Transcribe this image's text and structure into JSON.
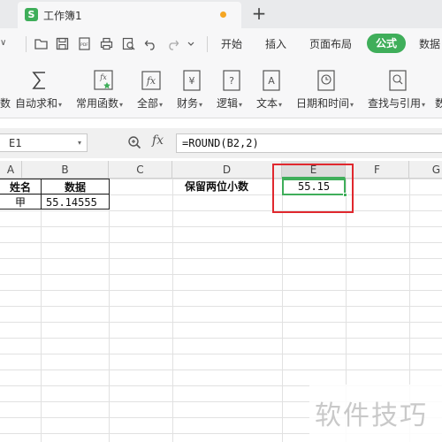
{
  "tab": {
    "title": "工作簿1",
    "app_icon_letter": "S",
    "new_tab": "+"
  },
  "menu": {
    "caret": "∨",
    "items": [
      "开始",
      "插入",
      "页面布局"
    ],
    "active": "公式",
    "cut_off": "数据"
  },
  "ribbon": {
    "left_cut": "数",
    "items": [
      {
        "label": "自动求和",
        "icon": "sigma-icon"
      },
      {
        "label": "常用函数",
        "icon": "function-star-icon"
      },
      {
        "label": "全部",
        "icon": "fx-icon"
      },
      {
        "label": "财务",
        "icon": "yen-book-icon"
      },
      {
        "label": "逻辑",
        "icon": "question-book-icon"
      },
      {
        "label": "文本",
        "icon": "text-book-icon"
      },
      {
        "label": "日期和时间",
        "icon": "clock-book-icon"
      },
      {
        "label": "查找与引用",
        "icon": "search-book-icon"
      }
    ],
    "right_cut": "数"
  },
  "formula_bar": {
    "name_box": "E1",
    "fx": "fx",
    "formula": "=ROUND(B2,2)"
  },
  "columns": [
    "A",
    "B",
    "C",
    "D",
    "E",
    "F",
    "G"
  ],
  "active_column": "E",
  "cells": {
    "A1": "姓名",
    "B1": "数据",
    "A2": "甲",
    "B2": "55.14555",
    "D1": "保留两位小数",
    "E1": "55.15"
  },
  "watermark": "软件技巧",
  "colors": {
    "accent": "#3fae5a",
    "highlight": "#e0282e",
    "modified_dot": "#f5a623"
  }
}
